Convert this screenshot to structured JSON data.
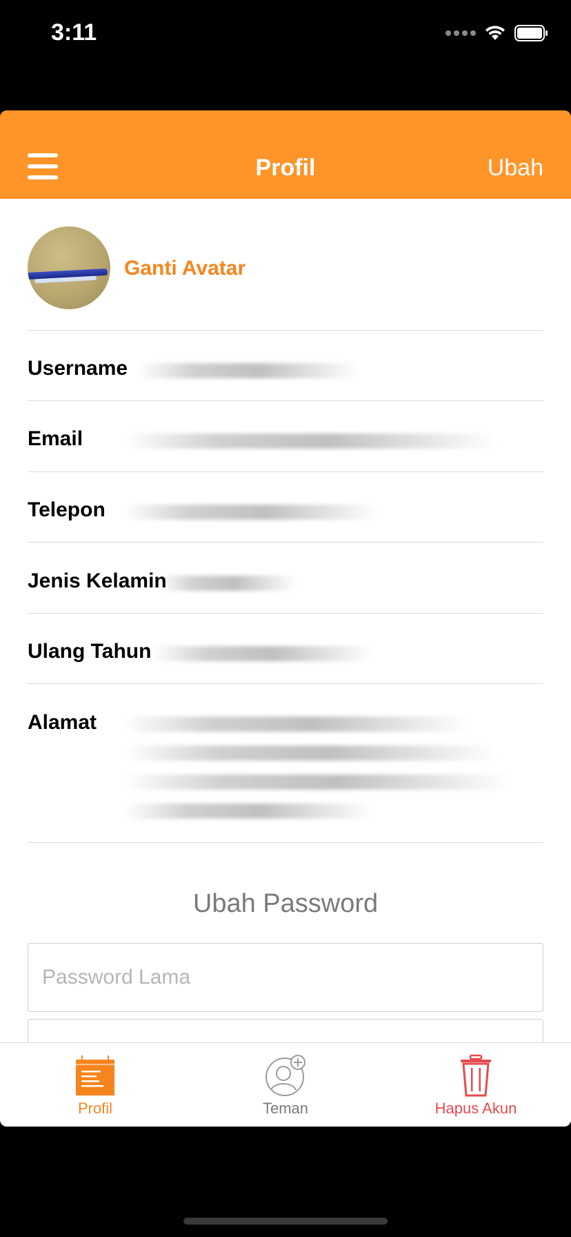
{
  "status_bar": {
    "time": "3:11"
  },
  "nav": {
    "title": "Profil",
    "edit_label": "Ubah"
  },
  "profile": {
    "change_avatar_label": "Ganti Avatar",
    "fields": [
      {
        "label": "Username"
      },
      {
        "label": "Email"
      },
      {
        "label": "Telepon"
      },
      {
        "label": "Jenis Kelamin"
      },
      {
        "label": "Ulang Tahun"
      },
      {
        "label": "Alamat"
      }
    ]
  },
  "password": {
    "section_title": "Ubah Password",
    "old_placeholder": "Password Lama"
  },
  "tabs": [
    {
      "label": "Profil",
      "icon": "calendar-list-icon",
      "color": "#F7851E"
    },
    {
      "label": "Teman",
      "icon": "add-friend-icon",
      "color": "#7a7a7a"
    },
    {
      "label": "Hapus Akun",
      "icon": "trash-icon",
      "color": "#E8494B"
    }
  ],
  "colors": {
    "accent": "#FF9428",
    "accent_text": "#F7851E",
    "danger": "#E8494B"
  }
}
